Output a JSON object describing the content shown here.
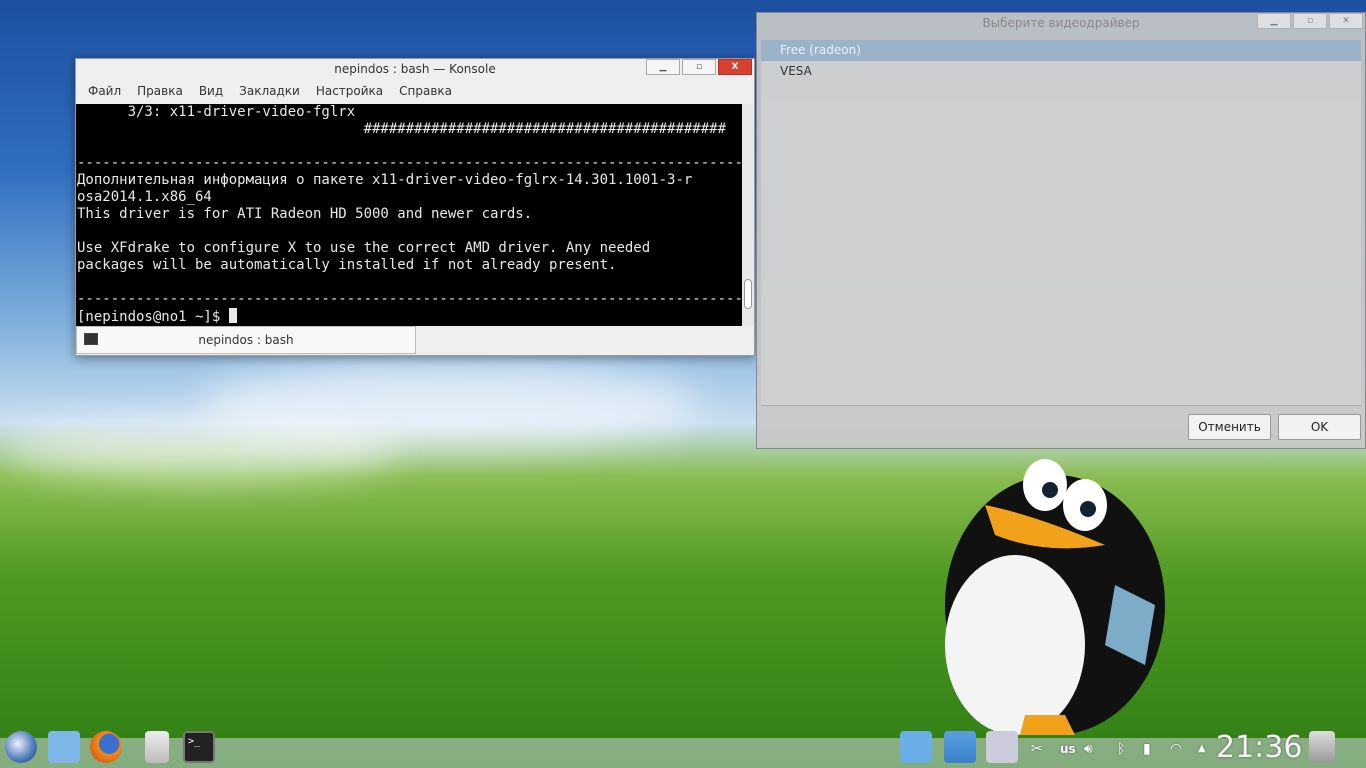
{
  "konsole": {
    "title": "nepindos : bash — Konsole",
    "menu": [
      "Файл",
      "Правка",
      "Вид",
      "Закладки",
      "Настройка",
      "Справка"
    ],
    "lines": [
      "      3/3: x11-driver-video-fglrx",
      "                                  ###########################################",
      "",
      "-------------------------------------------------------------------------------",
      "Дополнительная информация о пакете x11-driver-video-fglrx-14.301.1001-3-r",
      "osa2014.1.x86_64",
      "This driver is for ATI Radeon HD 5000 and newer cards.",
      "",
      "Use XFdrake to configure X to use the correct AMD driver. Any needed",
      "packages will be automatically installed if not already present.",
      "",
      "-------------------------------------------------------------------------------"
    ],
    "prompt": "[nepindos@no1 ~]$ ",
    "tab": "nepindos : bash"
  },
  "dialog": {
    "title": "Выберите видеодрайвер",
    "items": [
      "Free (radeon)",
      "VESA"
    ],
    "cancel": "Отменить",
    "ok": "OK"
  },
  "panel": {
    "clock": "21:36",
    "layout": "us"
  }
}
